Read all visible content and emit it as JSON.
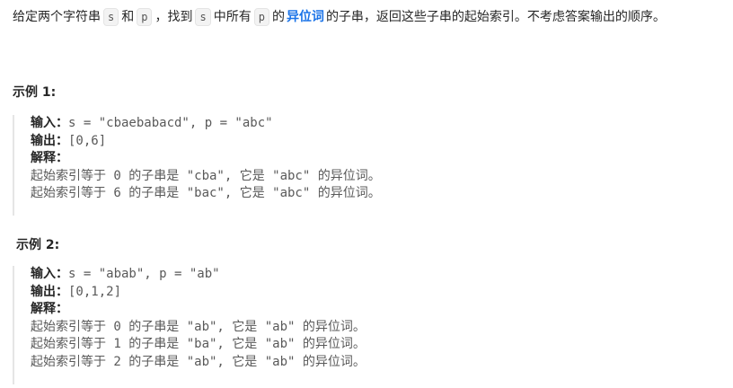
{
  "intro": {
    "t1": "给定两个字符串",
    "s": "s",
    "t2": "和",
    "p": "p",
    "t3": "，找到",
    "s2": "s",
    "t4": "中所有",
    "p2": "p",
    "t5": "的",
    "term": "异位词",
    "t6": "的子串，返回这些子串的起始索引。不考虑答案输出的顺序。"
  },
  "examples": [
    {
      "title": "示例 1:",
      "input_label": "输入：",
      "input_value": "s = \"cbaebabacd\", p = \"abc\"",
      "output_label": "输出：",
      "output_value": "[0,6]",
      "explain_label": "解释：",
      "explain_lines": [
        "起始索引等于 0 的子串是 \"cba\", 它是 \"abc\" 的异位词。",
        "起始索引等于 6 的子串是 \"bac\", 它是 \"abc\" 的异位词。"
      ]
    },
    {
      "title": "示例 2:",
      "input_label": "输入：",
      "input_value": "s = \"abab\", p = \"ab\"",
      "output_label": "输出：",
      "output_value": "[0,1,2]",
      "explain_label": "解释：",
      "explain_lines": [
        "起始索引等于 0 的子串是 \"ab\", 它是 \"ab\" 的异位词。",
        "起始索引等于 1 的子串是 \"ba\", 它是 \"ab\" 的异位词。",
        "起始索引等于 2 的子串是 \"ab\", 它是 \"ab\" 的异位词。"
      ]
    }
  ],
  "colors": {
    "link": "#1a73e8",
    "text": "#262626",
    "muted": "#595959"
  }
}
